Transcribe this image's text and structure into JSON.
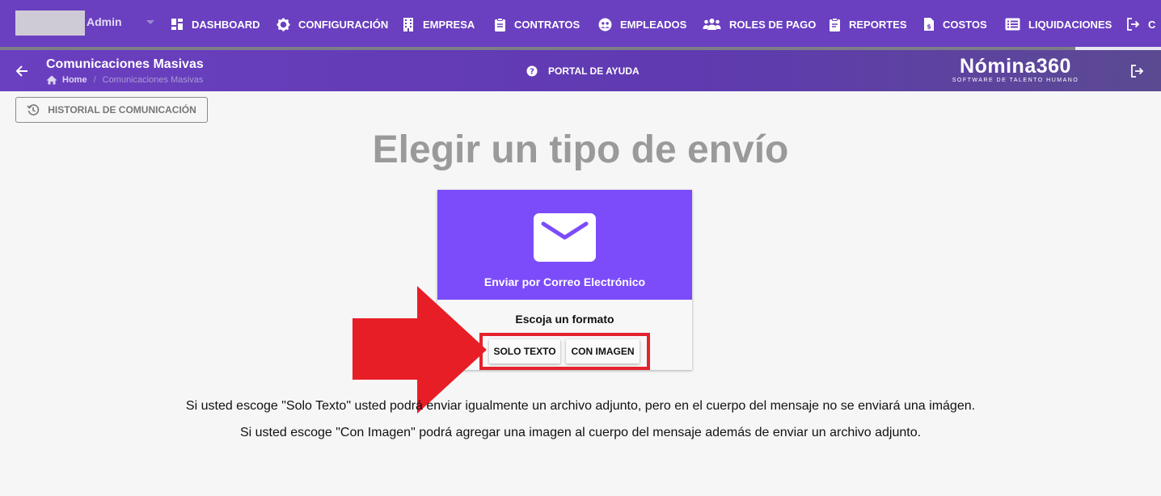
{
  "user": {
    "name": "Admin"
  },
  "nav": {
    "items": [
      {
        "label": "DASHBOARD",
        "icon": "dashboard-icon"
      },
      {
        "label": "CONFIGURACIÓN",
        "icon": "gear-icon"
      },
      {
        "label": "EMPRESA",
        "icon": "building-icon"
      },
      {
        "label": "CONTRATOS",
        "icon": "clipboard-icon"
      },
      {
        "label": "EMPLEADOS",
        "icon": "people-circle-icon"
      },
      {
        "label": "ROLES DE PAGO",
        "icon": "group-icon"
      },
      {
        "label": "REPORTES",
        "icon": "report-icon"
      },
      {
        "label": "COSTOS",
        "icon": "invoice-icon"
      },
      {
        "label": "LIQUIDACIONES",
        "icon": "list-icon"
      },
      {
        "label": "C",
        "icon": "logout-icon"
      }
    ]
  },
  "subheader": {
    "title": "Comunicaciones Masivas",
    "breadcrumb_home": "Home",
    "breadcrumb_current": "Comunicaciones Masivas",
    "help_label": "PORTAL DE AYUDA",
    "logo_main": "Nómina360",
    "logo_sub": "SOFTWARE DE TALENTO HUMANO"
  },
  "main": {
    "history_button": "HISTORIAL DE COMUNICACIÓN",
    "heading": "Elegir un tipo de envío",
    "card": {
      "title": "Enviar por Correo Electrónico",
      "format_label": "Escoja un formato",
      "solo_texto": "SOLO TEXTO",
      "con_imagen": "CON IMAGEN"
    },
    "note1": "Si usted escoge \"Solo Texto\" usted podrá enviar igualmente un archivo adjunto, pero en el cuerpo del mensaje no se enviará una imágen.",
    "note2": "Si usted escoge \"Con Imagen\" podrá agregar una imagen al cuerpo del mensaje además de enviar un archivo adjunto."
  },
  "colors": {
    "nav_bg": "#6a3fc0",
    "card_accent": "#7c4cfa",
    "highlight": "#e3222d"
  }
}
